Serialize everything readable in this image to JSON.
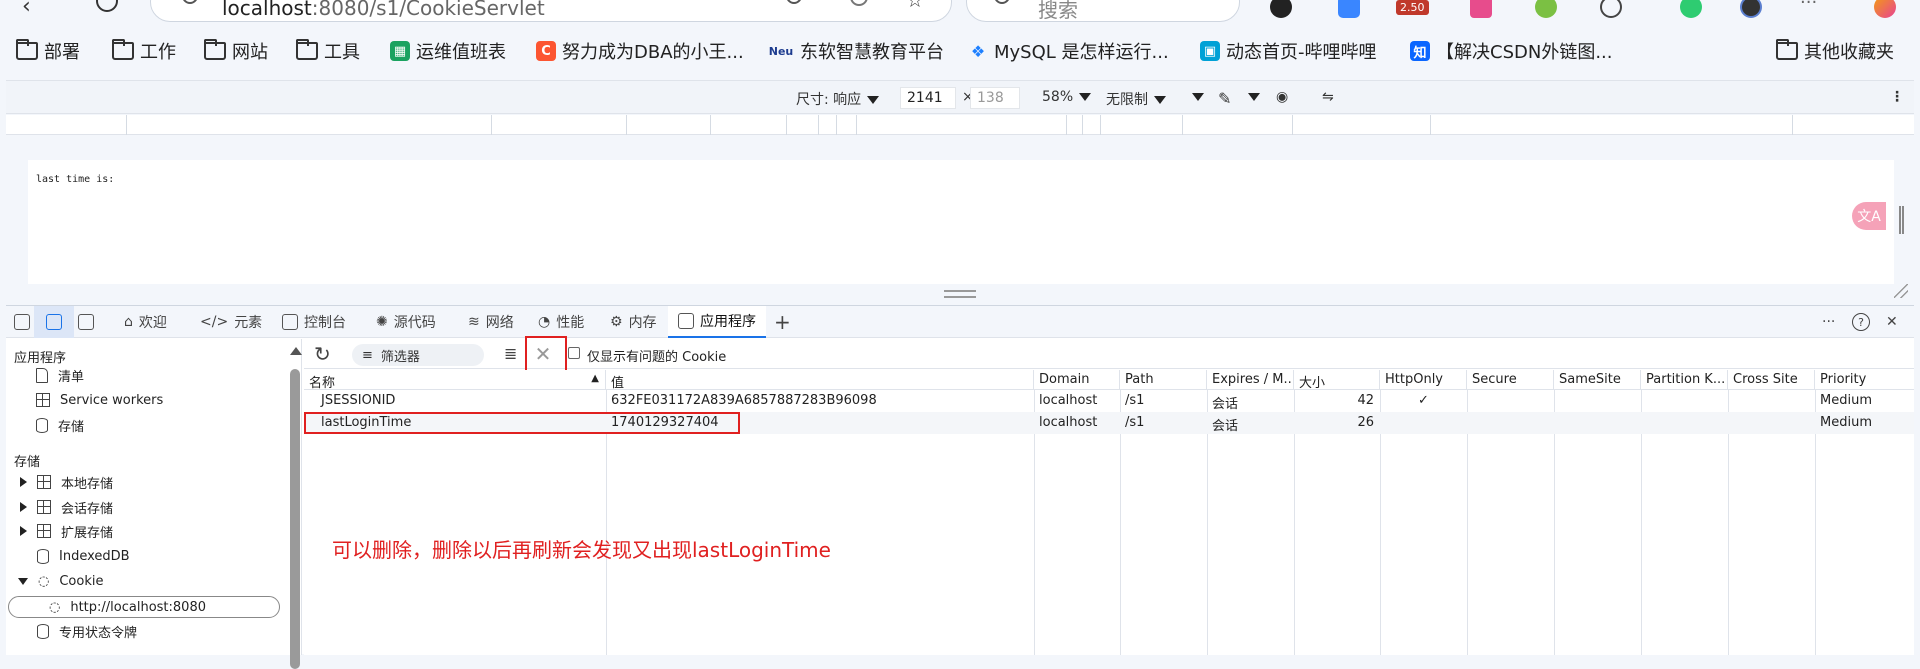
{
  "browser": {
    "url_host": "localhost",
    "url_rest": ":8080/s1/CookieServlet",
    "search_placeholder": "搜索",
    "badge_price": "2.50"
  },
  "bookmarks": [
    {
      "label": "部署",
      "icon": "folder-icon"
    },
    {
      "label": "工作",
      "icon": "folder-icon"
    },
    {
      "label": "网站",
      "icon": "folder-icon"
    },
    {
      "label": "工具",
      "icon": "folder-icon"
    },
    {
      "label": "运维值班表",
      "icon": "sheet-icon"
    },
    {
      "label": "努力成为DBA的小王...",
      "icon": "csdn-icon"
    },
    {
      "label": "东软智慧教育平台",
      "icon": "neu-icon"
    },
    {
      "label": "MySQL 是怎样运行...",
      "icon": "juejin-icon"
    },
    {
      "label": "动态首页-哔哩哔哩",
      "icon": "bilibili-icon"
    },
    {
      "label": "【解决CSDN外链图...",
      "icon": "zhihu-icon"
    },
    {
      "label": "其他收藏夹",
      "icon": "folder-icon"
    }
  ],
  "device_toolbar": {
    "size_label": "尺寸: 响应",
    "width": "2141",
    "times": "×",
    "height_placeholder": "138",
    "zoom": "58%",
    "throttle": "无限制"
  },
  "viewport": {
    "page_text": "last time is:",
    "translate_icon": "文A"
  },
  "devtools": {
    "tabs": [
      {
        "label": "欢迎",
        "icon": "home-icon"
      },
      {
        "label": "元素",
        "icon": "code-icon"
      },
      {
        "label": "控制台",
        "icon": "console-icon"
      },
      {
        "label": "源代码",
        "icon": "bug-icon"
      },
      {
        "label": "网络",
        "icon": "wifi-icon"
      },
      {
        "label": "性能",
        "icon": "gauge-icon"
      },
      {
        "label": "内存",
        "icon": "chip-icon"
      },
      {
        "label": "应用程序",
        "icon": "app-icon",
        "active": true
      }
    ],
    "add_tab": "+",
    "more": "···",
    "help": "?",
    "close": "✕"
  },
  "sidebar": {
    "section_app": "应用程序",
    "app_items": [
      "清单",
      "Service workers",
      "存储"
    ],
    "section_storage": "存储",
    "storage_items": [
      "本地存储",
      "会话存储",
      "扩展存储",
      "IndexedDB",
      "Cookie"
    ],
    "cookie_child": "http://localhost:8080",
    "last_item": "专用状态令牌"
  },
  "cookie_toolbar": {
    "filter_placeholder": "筛选器",
    "clear_icon": "✕",
    "only_problem_label": "仅显示有问题的 Cookie"
  },
  "table": {
    "columns": [
      "名称",
      "值",
      "Domain",
      "Path",
      "Expires / M...",
      "大小",
      "HttpOnly",
      "Secure",
      "SameSite",
      "Partition K...",
      "Cross Site",
      "Priority"
    ],
    "rows": [
      {
        "name": "JSESSIONID",
        "value": "632FE031172A839A6857887283B96098",
        "domain": "localhost",
        "path": "/s1",
        "expires": "会话",
        "size": "42",
        "httponly": "✓",
        "secure": "",
        "samesite": "",
        "partition": "",
        "cross": "",
        "priority": "Medium"
      },
      {
        "name": "lastLoginTime",
        "value": "1740129327404",
        "domain": "localhost",
        "path": "/s1",
        "expires": "会话",
        "size": "26",
        "httponly": "",
        "secure": "",
        "samesite": "",
        "partition": "",
        "cross": "",
        "priority": "Medium"
      }
    ]
  },
  "annotation": "可以删除，删除以后再刷新会发现又出现lastLoginTime",
  "colors": {
    "highlight": "#e02020",
    "accent": "#1a73e8"
  }
}
